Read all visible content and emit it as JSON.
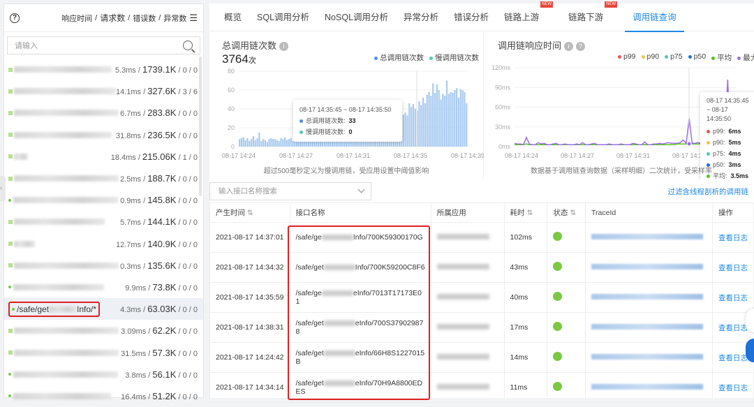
{
  "left": {
    "sort_labels": [
      "响应时间",
      "请求数",
      "错误数",
      "异常数"
    ],
    "search_placeholder": "请输入",
    "items": [
      {
        "rt": "5.3ms",
        "req": "1739.1K",
        "err": "0",
        "exc": "0",
        "mark": "sq"
      },
      {
        "rt": "14.1ms",
        "req": "327.6K",
        "err": "3",
        "exc": "6",
        "mark": "sq"
      },
      {
        "rt": "6.7ms",
        "req": "283.8K",
        "err": "0",
        "exc": "0",
        "mark": "sq"
      },
      {
        "rt": "31.8ms",
        "req": "236.5K",
        "err": "0",
        "exc": "0",
        "mark": "sq"
      },
      {
        "rt": "18.4ms",
        "req": "215.06K",
        "err": "1",
        "exc": "0",
        "mark": "sq"
      },
      {
        "rt": "2.5ms",
        "req": "188.7K",
        "err": "0",
        "exc": "0",
        "mark": "sq"
      },
      {
        "rt": "0.9ms",
        "req": "145.8K",
        "err": "0",
        "exc": "0",
        "mark": "dot"
      },
      {
        "rt": "5.7ms",
        "req": "144.1K",
        "err": "0",
        "exc": "0",
        "mark": "sq"
      },
      {
        "rt": "12.7ms",
        "req": "140.9K",
        "err": "0",
        "exc": "0",
        "mark": "sq"
      },
      {
        "rt": "0.3ms",
        "req": "135.6K",
        "err": "0",
        "exc": "0",
        "mark": "sq"
      },
      {
        "rt": "9.9ms",
        "req": "73.8K",
        "err": "0",
        "exc": "0",
        "mark": "dot"
      },
      {
        "rt": "4.3ms",
        "req": "63.03K",
        "err": "0",
        "exc": "0",
        "mark": "dot",
        "name_prefix": "/safe/get",
        "name_suffix": "Info/*",
        "selected": true
      },
      {
        "rt": "3.09ms",
        "req": "62.2K",
        "err": "0",
        "exc": "0",
        "mark": "sq"
      },
      {
        "rt": "31.5ms",
        "req": "57.3K",
        "err": "0",
        "exc": "0",
        "mark": "sq"
      },
      {
        "rt": "3.8ms",
        "req": "56.1K",
        "err": "0",
        "exc": "0",
        "mark": "dot"
      },
      {
        "rt": "16.4ms",
        "req": "51.2K",
        "err": "0",
        "exc": "0",
        "mark": "dot"
      }
    ]
  },
  "tabs": [
    {
      "label": "概览"
    },
    {
      "label": "SQL调用分析"
    },
    {
      "label": "NoSQL调用分析"
    },
    {
      "label": "异常分析"
    },
    {
      "label": "错误分析"
    },
    {
      "label": "链路上游",
      "badge": "NEW"
    },
    {
      "label": "链路下游",
      "badge": "NEW"
    },
    {
      "label": "调用链查询",
      "active": true
    }
  ],
  "chart_data": [
    {
      "type": "bar",
      "title": "总调用链次数",
      "total": "3764",
      "total_unit": "次",
      "legend": [
        "总调用链次数",
        "慢调用链次数"
      ],
      "colors": {
        "total": "#4a90e2",
        "slow": "#4fc9b0"
      },
      "ylim": [
        0,
        80
      ],
      "yticks": [
        0,
        20,
        40,
        60,
        80
      ],
      "xticks": [
        "08-17 14:24",
        "08-17 14:27",
        "08-17 14:31",
        "08-17 14:35",
        "08-17 14:39"
      ],
      "values": [
        8,
        9,
        10,
        7,
        9,
        6,
        8,
        11,
        7,
        9,
        15,
        6,
        8,
        7,
        5,
        8,
        9,
        8,
        8,
        7,
        6,
        9,
        8,
        10,
        7,
        8,
        9,
        6,
        11,
        8,
        7,
        9,
        10,
        6,
        8,
        9,
        7,
        8,
        10,
        9,
        8,
        11,
        7,
        9,
        8,
        10,
        12,
        9,
        8,
        11,
        10,
        9,
        8,
        11,
        10,
        12,
        9,
        8,
        10,
        11,
        14,
        10,
        12,
        11,
        13,
        12,
        15,
        14,
        12,
        16,
        18,
        20,
        17,
        22,
        25,
        21,
        24,
        28,
        30,
        27,
        35,
        33,
        38,
        34,
        36,
        33,
        46,
        42,
        45,
        40,
        38,
        48,
        44,
        52,
        46,
        55,
        58,
        54,
        67,
        57,
        66,
        60,
        50,
        56,
        54,
        70,
        56,
        58,
        57,
        60,
        62,
        52,
        61,
        60,
        58,
        46
      ],
      "tooltip": {
        "range": "08-17 14:35:45 ~ 08-17 14:35:50",
        "rows": [
          {
            "label": "总调用链次数:",
            "value": "33"
          },
          {
            "label": "慢调用链次数:",
            "value": "0"
          }
        ]
      },
      "note": "超过500毫秒定义为慢调用链，受应用设置中阈值影响"
    },
    {
      "type": "line",
      "title": "调用链响应时间",
      "legend": [
        "p99",
        "p90",
        "p75",
        "p50",
        "平均",
        "最大"
      ],
      "colors": {
        "p99": "#e8584f",
        "p90": "#f5c342",
        "p75": "#4fc9b0",
        "p50": "#1e6fd9",
        "avg": "#52c41a",
        "max": "#9b6fe8"
      },
      "ylim": [
        0,
        120
      ],
      "yticks": [
        "0ms",
        "30ms",
        "60ms",
        "90ms",
        "120ms"
      ],
      "xticks": [
        "08-17 14:24",
        "08-17 14:27",
        "08-17 14:31",
        "08-17 14:35"
      ],
      "max_values": [
        5,
        4,
        4,
        3,
        14,
        4,
        3,
        3,
        6,
        4,
        5,
        3,
        3,
        4,
        5,
        3,
        3,
        4,
        3,
        3,
        3,
        4,
        3,
        6,
        3,
        3,
        4,
        5,
        3,
        3,
        3,
        3,
        4,
        3,
        3,
        3,
        4,
        3,
        3,
        3,
        5,
        4,
        3,
        3,
        7,
        3,
        3,
        4,
        4,
        5,
        4,
        5,
        6,
        5,
        5,
        5,
        6,
        10,
        5,
        43,
        5,
        5,
        6,
        5,
        4,
        5,
        40,
        6,
        5,
        5,
        6,
        5,
        102,
        8,
        6,
        6
      ],
      "avg_values": [
        3,
        3,
        3,
        3,
        4,
        3,
        3,
        3,
        3,
        3,
        3,
        3,
        3,
        3,
        3,
        3,
        3,
        3,
        3,
        3,
        3,
        3,
        3,
        3,
        3,
        3,
        3,
        3,
        3,
        3,
        3,
        3,
        3,
        3,
        3,
        3,
        3,
        3,
        3,
        3,
        3,
        3,
        3,
        3,
        3,
        3,
        3,
        3,
        3,
        3,
        3,
        3,
        3,
        3,
        3,
        4,
        4,
        4,
        4,
        5,
        4,
        4,
        4,
        4,
        3.5,
        4,
        4,
        4,
        4,
        4,
        4,
        4,
        6,
        5,
        4,
        4
      ],
      "tooltip": {
        "range": "08-17 14:35:45 ~ 08-17 14:35:50",
        "rows": [
          {
            "label": "p99:",
            "value": "6ms"
          },
          {
            "label": "p90:",
            "value": "5ms"
          },
          {
            "label": "p75:",
            "value": "4ms"
          },
          {
            "label": "p50:",
            "value": "3ms"
          },
          {
            "label": "平均:",
            "value": "3.5ms"
          }
        ]
      },
      "note": "数据基于调用链查询数据（采样明细）二次统计，受采样率"
    }
  ],
  "table": {
    "search_placeholder": "输入接口名称搜索",
    "filter_link": "过滤含线程剖析的调用链",
    "headers": [
      "产生时间",
      "接口名称",
      "所属应用",
      "耗时",
      "状态",
      "TraceId",
      "操作"
    ],
    "rows": [
      {
        "time": "2021-08-17 14:37:01",
        "if_prefix": "/safe/ge",
        "if_suffix": "Info/700K59300170G",
        "dur": "102ms",
        "action": "查看日志"
      },
      {
        "time": "2021-08-17 14:34:32",
        "if_prefix": "/safe/get",
        "if_suffix": "Info/700K59200C8F6",
        "dur": "43ms",
        "action": "查看日志"
      },
      {
        "time": "2021-08-17 14:35:59",
        "if_prefix": "/safe/ge",
        "if_suffix": "eInfo/7013T17173E01",
        "dur": "40ms",
        "action": "查看日志"
      },
      {
        "time": "2021-08-17 14:38:31",
        "if_prefix": "/safe/get",
        "if_suffix": "eInfo/700S379029878",
        "dur": "17ms",
        "action": "查看日志"
      },
      {
        "time": "2021-08-17 14:24:42",
        "if_prefix": "/safe/get",
        "if_suffix": "eInfo/66H8S1227015B",
        "dur": "14ms",
        "action": "查看日志"
      },
      {
        "time": "2021-08-17 14:34:14",
        "if_prefix": "/safe/get",
        "if_suffix": "eInfo/70H9A8800EDES",
        "dur": "11ms",
        "action": "查看日志"
      }
    ]
  }
}
